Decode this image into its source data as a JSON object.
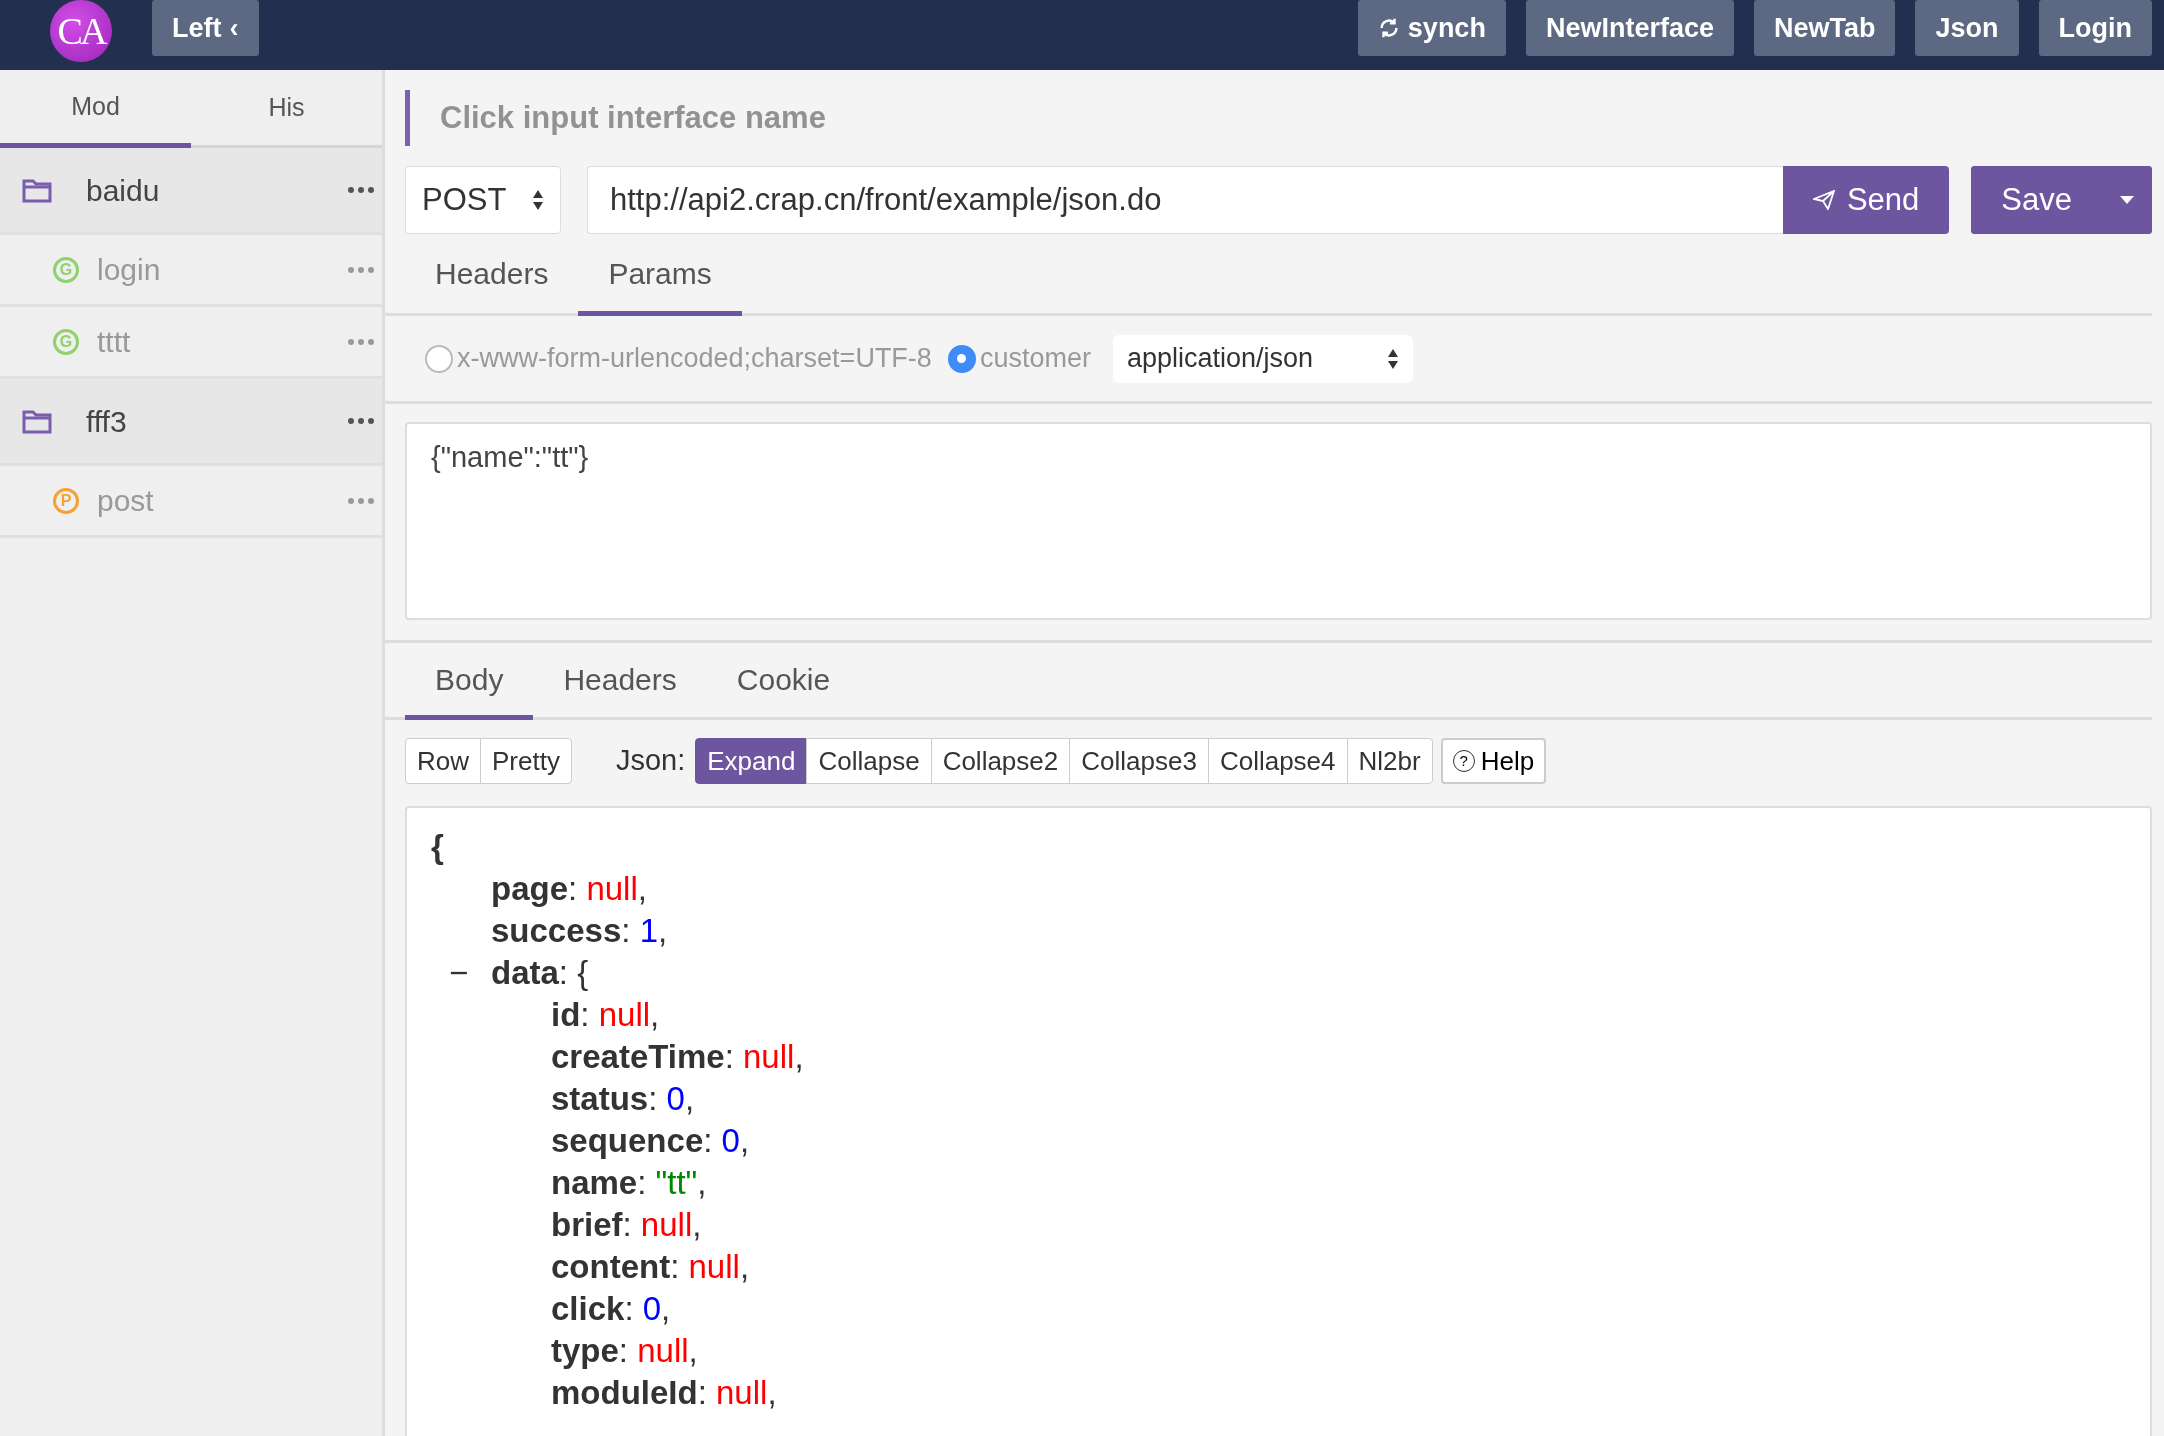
{
  "navbar": {
    "logo": "CA",
    "toggle": {
      "label": "Left",
      "icon": "‹"
    },
    "buttons": [
      {
        "label": "synch",
        "kind": "sync"
      },
      {
        "label": "NewInterface",
        "kind": "plain"
      },
      {
        "label": "NewTab",
        "kind": "plain"
      },
      {
        "label": "Json",
        "kind": "plain"
      },
      {
        "label": "Login",
        "kind": "plain"
      }
    ]
  },
  "sidebar": {
    "tabs": [
      {
        "label": "Mod",
        "selected": true
      },
      {
        "label": "His",
        "selected": false
      }
    ],
    "items": [
      {
        "name": "baidu",
        "kind": "folder",
        "children": [
          {
            "name": "login",
            "kind": "interface",
            "method": "G",
            "color": "#8fd16a"
          },
          {
            "name": "tttt",
            "kind": "interface",
            "method": "G",
            "color": "#8fd16a"
          }
        ]
      },
      {
        "name": "fff3",
        "kind": "folder",
        "children": [
          {
            "name": "post",
            "kind": "interface",
            "method": "P",
            "color": "#f7a035"
          }
        ]
      }
    ]
  },
  "request": {
    "name_placeholder": "Click input interface name",
    "method": "POST",
    "url": "http://api2.crap.cn/front/example/json.do",
    "send": "Send",
    "save": "Save",
    "tabs": [
      {
        "label": "Headers",
        "selected": false
      },
      {
        "label": "Params",
        "selected": true
      }
    ],
    "content_types": [
      {
        "label": "x-www-form-urlencoded;charset=UTF-8",
        "selected": false
      },
      {
        "label": "customer",
        "selected": true
      }
    ],
    "custom_type": "application/json",
    "body": "{\"name\":\"tt\"}"
  },
  "response": {
    "tabs": [
      {
        "label": "Body",
        "selected": true
      },
      {
        "label": "Headers",
        "selected": false
      },
      {
        "label": "Cookie",
        "selected": false
      }
    ],
    "format_buttons": [
      {
        "label": "Row",
        "selected": false
      },
      {
        "label": "Pretty",
        "selected": false
      }
    ],
    "json_label": "Json:",
    "json_buttons": [
      {
        "label": "Expand",
        "selected": true
      },
      {
        "label": "Collapse",
        "selected": false
      },
      {
        "label": "Collapse2",
        "selected": false
      },
      {
        "label": "Collapse3",
        "selected": false
      },
      {
        "label": "Collapse4",
        "selected": false
      },
      {
        "label": "Nl2br",
        "selected": false
      }
    ],
    "help": {
      "icon": "?",
      "label": "Help"
    },
    "json": {
      "open": "{",
      "entries": [
        {
          "key": "page",
          "sep": ":",
          "kind": "null",
          "value": "null",
          "end": ","
        },
        {
          "key": "success",
          "sep": ":",
          "kind": "number",
          "value": "1",
          "end": ","
        },
        {
          "key": "data",
          "sep": ":",
          "kind": "object",
          "open": "{",
          "toggle": "−",
          "expanded": true,
          "children": [
            {
              "key": "id",
              "sep": ":",
              "kind": "null",
              "value": "null",
              "end": ","
            },
            {
              "key": "createTime",
              "sep": ":",
              "kind": "null",
              "value": "null",
              "end": ","
            },
            {
              "key": "status",
              "sep": ":",
              "kind": "number",
              "value": "0",
              "end": ","
            },
            {
              "key": "sequence",
              "sep": ":",
              "kind": "number",
              "value": "0",
              "end": ","
            },
            {
              "key": "name",
              "sep": ":",
              "kind": "string",
              "value": "\"tt\"",
              "end": ","
            },
            {
              "key": "brief",
              "sep": ":",
              "kind": "null",
              "value": "null",
              "end": ","
            },
            {
              "key": "content",
              "sep": ":",
              "kind": "null",
              "value": "null",
              "end": ","
            },
            {
              "key": "click",
              "sep": ":",
              "kind": "number",
              "value": "0",
              "end": ","
            },
            {
              "key": "type",
              "sep": ":",
              "kind": "null",
              "value": "null",
              "end": ","
            },
            {
              "key": "moduleId",
              "sep": ":",
              "kind": "null",
              "value": "null",
              "end": ","
            }
          ]
        }
      ]
    }
  }
}
